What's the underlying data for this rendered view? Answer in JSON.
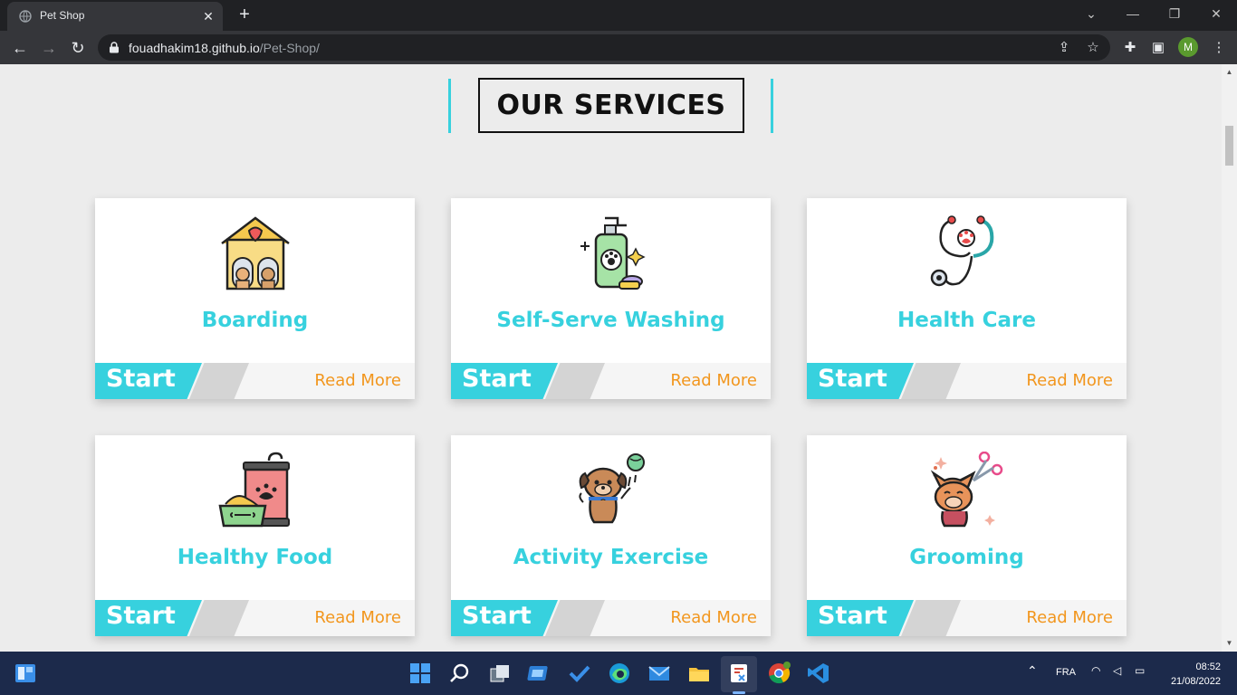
{
  "browser": {
    "tab_title": "Pet Shop",
    "url_host": "fouadhakim18.github.io",
    "url_path": "/Pet-Shop/",
    "profile_initial": "M",
    "accent": "#37d1de"
  },
  "page": {
    "heading": "OUR SERVICES",
    "services": [
      {
        "title": "Boarding",
        "icon": "dog-house-icon",
        "start": "Start",
        "read_more": "Read More"
      },
      {
        "title": "Self-Serve Washing",
        "icon": "shampoo-bottle-icon",
        "start": "Start",
        "read_more": "Read More"
      },
      {
        "title": "Health Care",
        "icon": "stethoscope-paw-icon",
        "start": "Start",
        "read_more": "Read More"
      },
      {
        "title": "Healthy Food",
        "icon": "pet-food-icon",
        "start": "Start",
        "read_more": "Read More"
      },
      {
        "title": "Activity Exercise",
        "icon": "playing-dog-icon",
        "start": "Start",
        "read_more": "Read More"
      },
      {
        "title": "Grooming",
        "icon": "cat-scissors-icon",
        "start": "Start",
        "read_more": "Read More"
      }
    ]
  },
  "taskbar": {
    "language": "FRA",
    "time": "08:52",
    "date": "21/08/2022"
  }
}
